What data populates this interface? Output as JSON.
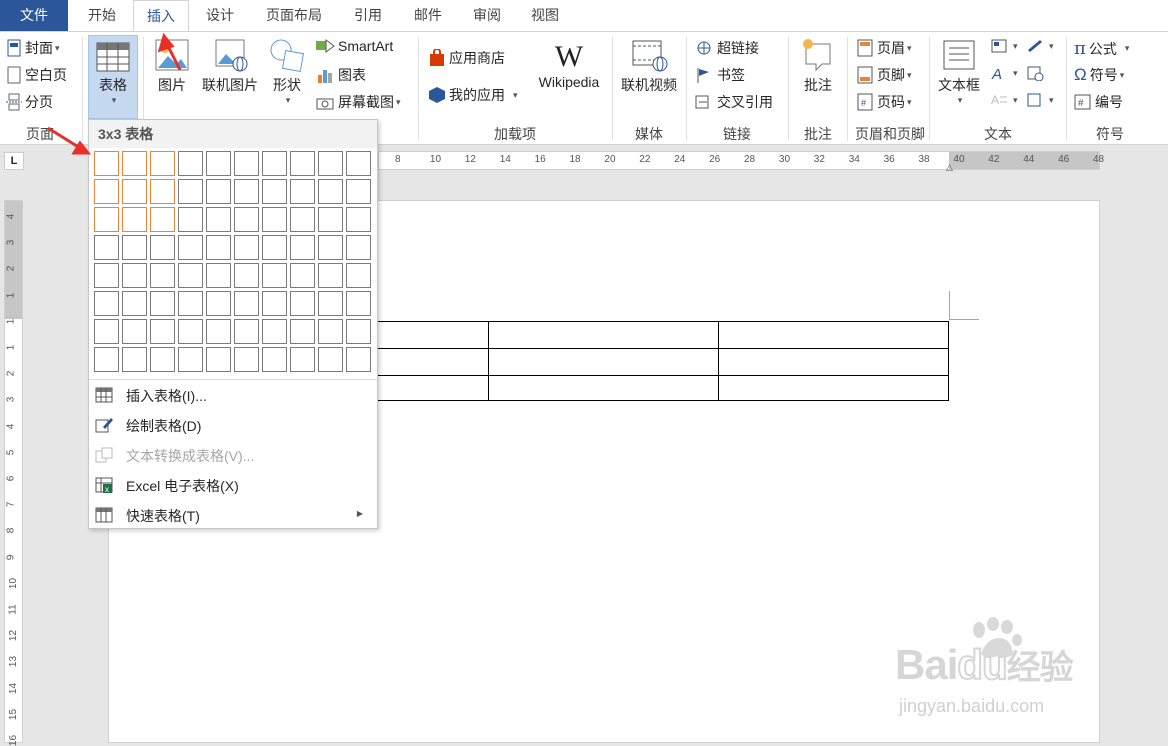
{
  "tabs": [
    "文件",
    "开始",
    "插入",
    "设计",
    "页面布局",
    "引用",
    "邮件",
    "审阅",
    "视图"
  ],
  "active_tab": "插入",
  "ribbon": {
    "pages": {
      "cover": "封面",
      "blank": "空白页",
      "break": "分页",
      "label": "页面"
    },
    "table": {
      "label": "表格"
    },
    "illustrations": {
      "picture": "图片",
      "online_picture": "联机图片",
      "shapes": "形状",
      "smartart": "SmartArt",
      "chart": "图表",
      "screenshot": "屏幕截图"
    },
    "addins": {
      "store": "应用商店",
      "my_apps": "我的应用",
      "wikipedia": "Wikipedia",
      "label": "加载项",
      "wiki_logo": "W"
    },
    "media": {
      "online_video": "联机视频",
      "label": "媒体"
    },
    "links": {
      "hyperlink": "超链接",
      "bookmark": "书签",
      "cross_ref": "交叉引用",
      "label": "链接"
    },
    "comments": {
      "comment": "批注",
      "label": "批注"
    },
    "header_footer": {
      "header": "页眉",
      "footer": "页脚",
      "page_number": "页码",
      "label": "页眉和页脚"
    },
    "text": {
      "textbox": "文本框",
      "label": "文本"
    },
    "symbols": {
      "equation": "公式",
      "symbol": "符号",
      "numbering": "编号",
      "label": "符号"
    }
  },
  "ruler": {
    "corner": "L",
    "h_ticks": [
      "8",
      "10",
      "12",
      "14",
      "16",
      "18",
      "20",
      "22",
      "24",
      "26",
      "28",
      "30",
      "32",
      "34",
      "36",
      "38",
      "40",
      "42",
      "44",
      "46",
      "48"
    ],
    "v_ticks": [
      "4",
      "3",
      "2",
      "1",
      "1",
      "1",
      "2",
      "3",
      "4",
      "5",
      "6",
      "7",
      "8",
      "9",
      "10",
      "11",
      "12",
      "13",
      "14",
      "15",
      "16"
    ]
  },
  "dropdown": {
    "title": "3x3 表格",
    "grid_cols": 10,
    "grid_rows": 8,
    "selected_cols": 3,
    "selected_rows": 3,
    "items": [
      {
        "label": "插入表格(I)...",
        "disabled": false,
        "submenu": false
      },
      {
        "label": "绘制表格(D)",
        "disabled": false,
        "submenu": false
      },
      {
        "label": "文本转换成表格(V)...",
        "disabled": true,
        "submenu": false
      },
      {
        "label": "Excel 电子表格(X)",
        "disabled": false,
        "submenu": false
      },
      {
        "label": "快速表格(T)",
        "disabled": false,
        "submenu": true
      }
    ]
  },
  "document_table": {
    "rows": 3,
    "cols": 3
  },
  "watermark": {
    "logo": "Bai",
    "logo2": "du",
    "brand": "经验",
    "url": "jingyan.baidu.com"
  },
  "colors": {
    "file_tab": "#2b579a",
    "highlight": "#e8833a",
    "arrow": "#e8302a"
  }
}
